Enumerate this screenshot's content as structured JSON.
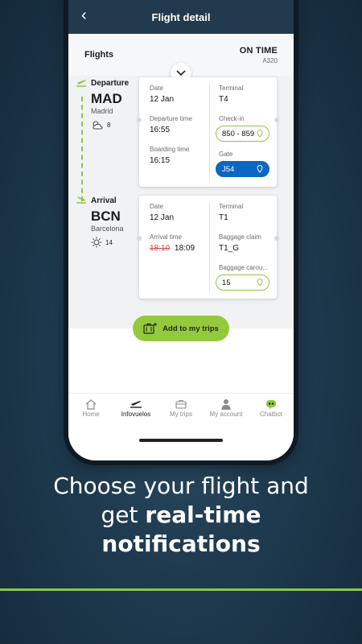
{
  "header": {
    "title": "Flight detail",
    "back": "‹"
  },
  "flights": {
    "label": "Flights",
    "status": "ON TIME",
    "aircraft": "A320"
  },
  "departure": {
    "label": "Departure",
    "code": "MAD",
    "city": "Madrid",
    "temp": "8",
    "weather_icon": "partly-cloudy-icon",
    "date_label": "Date",
    "date": "12 Jan",
    "dep_time_label": "Departure time",
    "dep_time": "16:55",
    "boarding_label": "Boarding time",
    "boarding": "16:15",
    "terminal_label": "Terminal",
    "terminal": "T4",
    "checkin_label": "Check-in",
    "checkin": "850 - 859",
    "gate_label": "Gate",
    "gate": "J54"
  },
  "arrival": {
    "label": "Arrival",
    "code": "BCN",
    "city": "Barcelona",
    "temp": "14",
    "weather_icon": "sun-icon",
    "date_label": "Date",
    "date": "12 Jan",
    "arr_time_label": "Arrival time",
    "arr_time_old": "18:10",
    "arr_time": "18:09",
    "terminal_label": "Terminal",
    "terminal": "T1",
    "baggage_claim_label": "Baggage claim",
    "baggage_claim": "T1_G",
    "carousel_label": "Baggage carou...",
    "carousel": "15"
  },
  "add_button": "Add to my trips",
  "nav": [
    {
      "label": "Home",
      "icon": "home-icon"
    },
    {
      "label": "Infovuelos",
      "icon": "plane-icon"
    },
    {
      "label": "My trips",
      "icon": "briefcase-icon"
    },
    {
      "label": "My account",
      "icon": "user-icon"
    },
    {
      "label": "Chatbot",
      "icon": "chatbot-icon"
    }
  ],
  "promo": {
    "line1": "Choose your flight and",
    "line2a": "get ",
    "line2b": "real-time",
    "line3": "notifications"
  },
  "colors": {
    "accent_green": "#8cc640",
    "header_navy": "#223a4d",
    "gate_blue": "#0b67c2",
    "delay_red": "#d04848"
  }
}
